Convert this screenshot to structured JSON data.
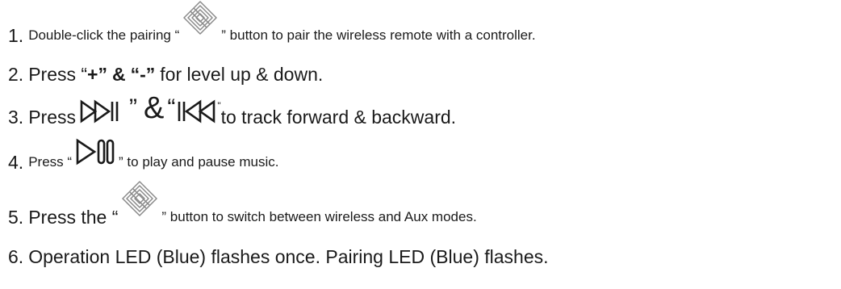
{
  "instructions": [
    {
      "number": "1.",
      "before": "Double-click the pairing “",
      "icon": "pairing-icon",
      "after": "” button to pair the wireless remote with a controller."
    },
    {
      "number": "2.",
      "before": "Press “",
      "plus": "+”",
      "amp": "&",
      "minus": "“-”",
      "after": "for level up & down."
    },
    {
      "number": "3.",
      "before": "Press",
      "icon_forward": "track-forward-icon",
      "close_quote": "”",
      "amp": "&",
      "open_quote": "“",
      "icon_backward": "track-backward-icon",
      "tiny_quote": "\"",
      "after": "to track forward & backward."
    },
    {
      "number": "4.",
      "before": "Press “",
      "icon": "play-pause-icon",
      "after": "” to play and pause music."
    },
    {
      "number": "5.",
      "before": "Press the “",
      "icon": "pairing-icon",
      "after": "” button to switch between wireless and Aux modes."
    },
    {
      "number": "6.",
      "text": "Operation LED (Blue) flashes once. Pairing LED (Blue) flashes."
    }
  ],
  "colors": {
    "text": "#1a1a1a",
    "icon_stroke": "#8a8a8a",
    "glyph": "#1a1a1a"
  }
}
